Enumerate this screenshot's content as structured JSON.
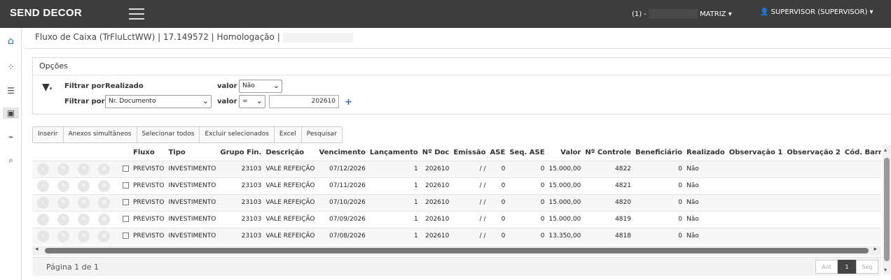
{
  "header": {
    "brand": "SEND DECOR",
    "company_prefix": "(1) -",
    "company_name": "MATRIZ",
    "user": "SUPERVISOR (SUPERVISOR)"
  },
  "breadcrumb": "Fluxo de Caixa (TrFluLctWW) | 17.149572 | Homologação |",
  "options": {
    "title": "Opções",
    "filter1": {
      "label": "Filtrar por",
      "field": "Realizado",
      "value_label": "valor",
      "value": "Não"
    },
    "filter2": {
      "label": "Filtrar por",
      "field": "Nr. Documento",
      "value_label": "valor",
      "operator": "=",
      "value": "202610"
    }
  },
  "toolbar": [
    "Inserir",
    "Anexos simultâneos",
    "Selecionar todos",
    "Excluir selecionados",
    "Excel",
    "Pesquisar"
  ],
  "columns": [
    "Fluxo",
    "Tipo",
    "Grupo Fin.",
    "Descrição",
    "Vencimento",
    "Lançamento",
    "Nº Doc",
    "Emissão",
    "ASE",
    "Seq. ASE",
    "Valor",
    "Nº Controle",
    "Beneficiário",
    "Realizado",
    "Observação 1",
    "Observação 2",
    "Cód. Barras"
  ],
  "rows": [
    [
      "PREVISTO",
      "INVESTIMENTO",
      "23103",
      "VALE REFEIÇÃO",
      "07/12/2026",
      "1",
      "202610",
      "/ /",
      "0",
      "0",
      "15.000,00",
      "4822",
      "0",
      "Não",
      "",
      "",
      ""
    ],
    [
      "PREVISTO",
      "INVESTIMENTO",
      "23103",
      "VALE REFEIÇÃO",
      "07/11/2026",
      "1",
      "202610",
      "/ /",
      "0",
      "0",
      "15.000,00",
      "4821",
      "0",
      "Não",
      "",
      "",
      ""
    ],
    [
      "PREVISTO",
      "INVESTIMENTO",
      "23103",
      "VALE REFEIÇÃO",
      "07/10/2026",
      "1",
      "202610",
      "/ /",
      "0",
      "0",
      "15.000,00",
      "4820",
      "0",
      "Não",
      "",
      "",
      ""
    ],
    [
      "PREVISTO",
      "INVESTIMENTO",
      "23103",
      "VALE REFEIÇÃO",
      "07/09/2026",
      "1",
      "202610",
      "/ /",
      "0",
      "0",
      "15.000,00",
      "4819",
      "0",
      "Não",
      "",
      "",
      ""
    ],
    [
      "PREVISTO",
      "INVESTIMENTO",
      "23103",
      "VALE REFEIÇÃO",
      "07/08/2026",
      "1",
      "202610",
      "/ /",
      "0",
      "0",
      "13.350,00",
      "4818",
      "0",
      "Não",
      "",
      "",
      ""
    ]
  ],
  "footer": {
    "page_info": "Página 1 de 1",
    "prev": "Ant",
    "current": "1",
    "next": "Seg"
  }
}
